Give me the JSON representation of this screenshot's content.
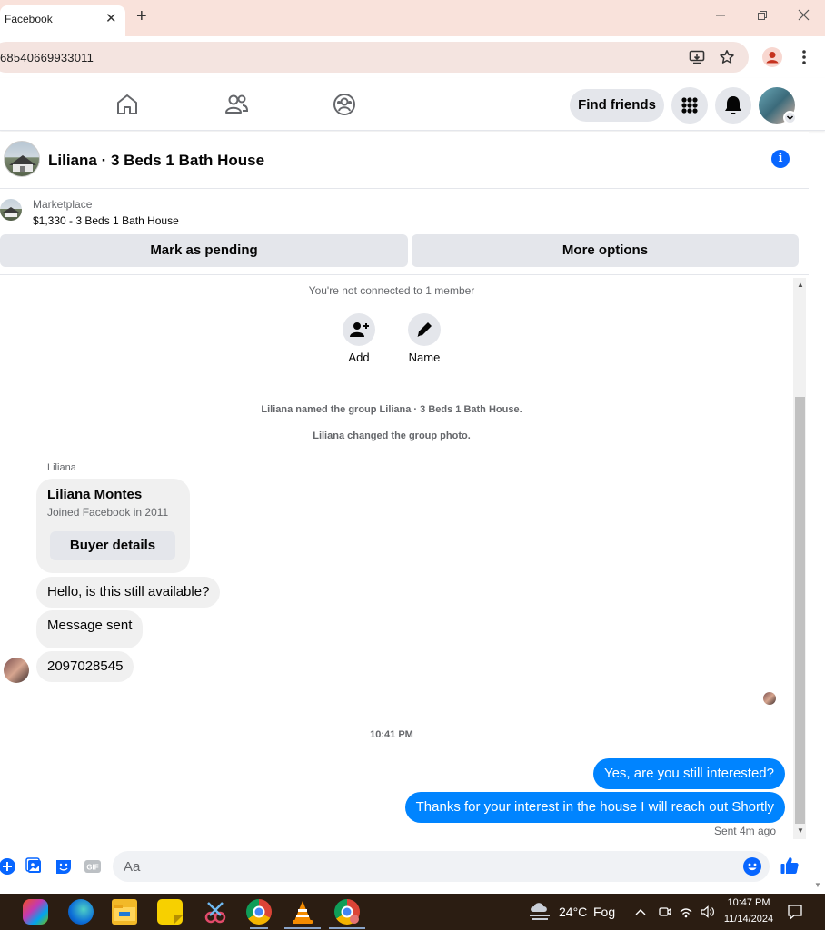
{
  "browser": {
    "tab_title": "Facebook",
    "tab_close": "✕",
    "new_tab": "+",
    "url": "68540669933011"
  },
  "fb_header": {
    "find_friends": "Find friends"
  },
  "chat": {
    "title": "Liliana · 3 Beds 1 Bath House",
    "marketplace_label": "Marketplace",
    "listing": "$1,330 - 3 Beds 1 Bath House",
    "mark_pending": "Mark as pending",
    "more_options": "More options"
  },
  "thread": {
    "not_connected": "You're not connected to 1 member",
    "add_label": "Add",
    "name_label": "Name",
    "system_named": "Liliana named the group Liliana · 3 Beds 1 Bath House.",
    "system_photo": "Liliana changed the group photo.",
    "sender": "Liliana",
    "card_name": "Liliana Montes",
    "card_sub": "Joined Facebook in 2011",
    "buyer_details": "Buyer details",
    "msg1": "Hello, is this still available?",
    "msg2": "Message sent",
    "msg3": "2097028545",
    "time_separator": "10:41 PM",
    "out1": "Yes, are you still interested?",
    "out2": "Thanks for your interest in the house I will reach out Shortly",
    "sent_status": "Sent 4m ago"
  },
  "composer": {
    "placeholder": "Aa"
  },
  "taskbar": {
    "temperature": "24°C",
    "weather": "Fog",
    "time": "10:47 PM",
    "date": "11/14/2024"
  },
  "colors": {
    "fb_blue": "#0866ff",
    "bubble_blue": "#0084ff",
    "bubble_grey": "#f0f0f0",
    "chrome_tab_bg": "#f9e2db"
  }
}
